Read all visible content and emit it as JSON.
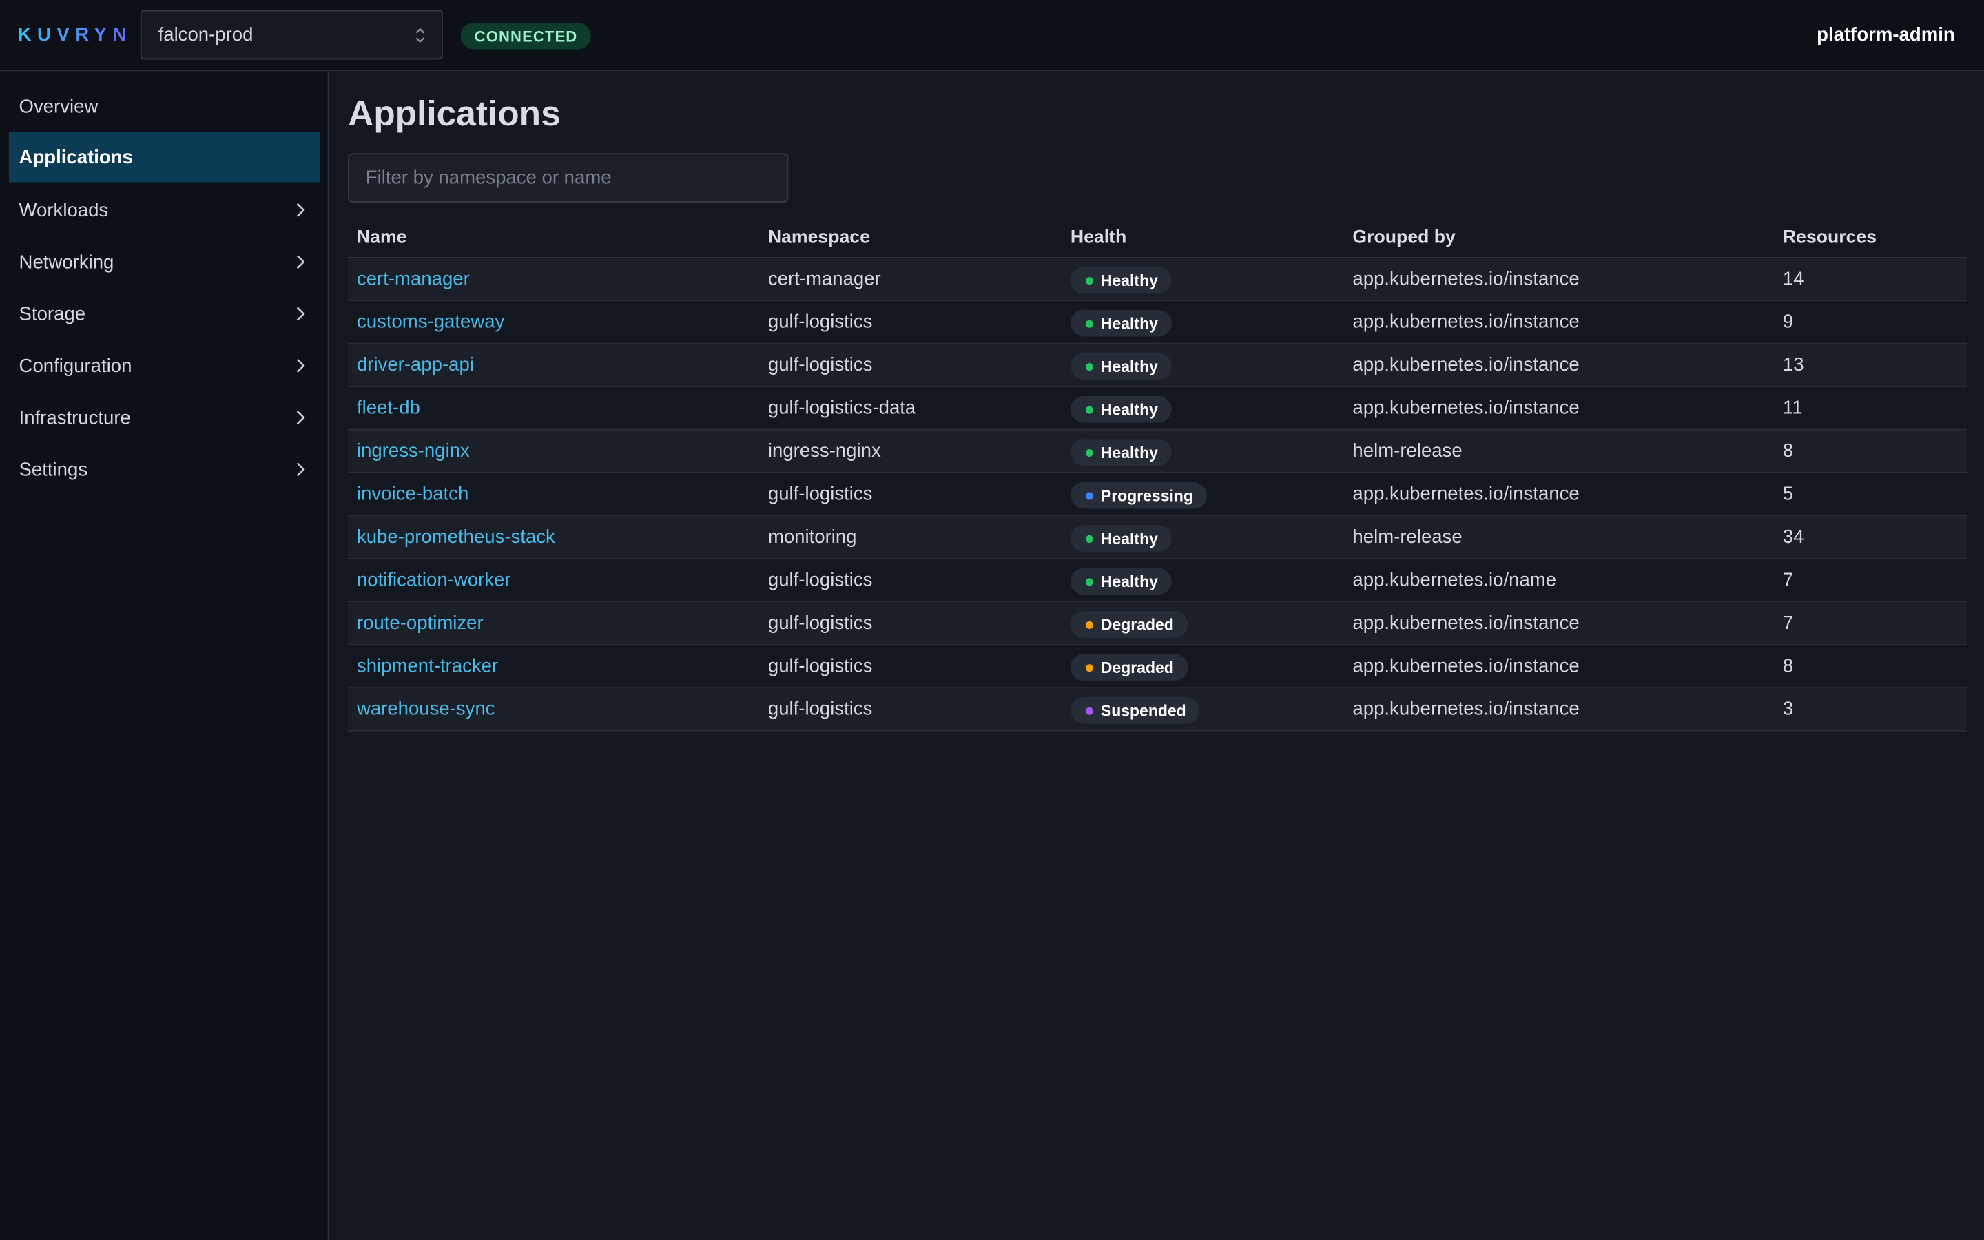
{
  "header": {
    "logo": "KUVRYN",
    "cluster": "falcon-prod",
    "status": "CONNECTED",
    "user": "platform-admin"
  },
  "sidebar": {
    "items": [
      {
        "label": "Overview",
        "active": false,
        "has_children": false
      },
      {
        "label": "Applications",
        "active": true,
        "has_children": false
      },
      {
        "label": "Workloads",
        "active": false,
        "has_children": true
      },
      {
        "label": "Networking",
        "active": false,
        "has_children": true
      },
      {
        "label": "Storage",
        "active": false,
        "has_children": true
      },
      {
        "label": "Configuration",
        "active": false,
        "has_children": true
      },
      {
        "label": "Infrastructure",
        "active": false,
        "has_children": true
      },
      {
        "label": "Settings",
        "active": false,
        "has_children": true
      }
    ]
  },
  "main": {
    "title": "Applications",
    "filter_placeholder": "Filter by namespace or name",
    "filter_value": "",
    "columns": [
      "Name",
      "Namespace",
      "Health",
      "Grouped by",
      "Resources"
    ],
    "rows": [
      {
        "name": "cert-manager",
        "namespace": "cert-manager",
        "health": "Healthy",
        "grouped_by": "app.kubernetes.io/instance",
        "resources": "14"
      },
      {
        "name": "customs-gateway",
        "namespace": "gulf-logistics",
        "health": "Healthy",
        "grouped_by": "app.kubernetes.io/instance",
        "resources": "9"
      },
      {
        "name": "driver-app-api",
        "namespace": "gulf-logistics",
        "health": "Healthy",
        "grouped_by": "app.kubernetes.io/instance",
        "resources": "13"
      },
      {
        "name": "fleet-db",
        "namespace": "gulf-logistics-data",
        "health": "Healthy",
        "grouped_by": "app.kubernetes.io/instance",
        "resources": "11"
      },
      {
        "name": "ingress-nginx",
        "namespace": "ingress-nginx",
        "health": "Healthy",
        "grouped_by": "helm-release",
        "resources": "8"
      },
      {
        "name": "invoice-batch",
        "namespace": "gulf-logistics",
        "health": "Progressing",
        "grouped_by": "app.kubernetes.io/instance",
        "resources": "5"
      },
      {
        "name": "kube-prometheus-stack",
        "namespace": "monitoring",
        "health": "Healthy",
        "grouped_by": "helm-release",
        "resources": "34"
      },
      {
        "name": "notification-worker",
        "namespace": "gulf-logistics",
        "health": "Healthy",
        "grouped_by": "app.kubernetes.io/name",
        "resources": "7"
      },
      {
        "name": "route-optimizer",
        "namespace": "gulf-logistics",
        "health": "Degraded",
        "grouped_by": "app.kubernetes.io/instance",
        "resources": "7"
      },
      {
        "name": "shipment-tracker",
        "namespace": "gulf-logistics",
        "health": "Degraded",
        "grouped_by": "app.kubernetes.io/instance",
        "resources": "8"
      },
      {
        "name": "warehouse-sync",
        "namespace": "gulf-logistics",
        "health": "Suspended",
        "grouped_by": "app.kubernetes.io/instance",
        "resources": "3"
      }
    ]
  },
  "colors": {
    "Healthy": "#22c55e",
    "Progressing": "#3b82f6",
    "Degraded": "#f59e0b",
    "Suspended": "#a855f7",
    "link": "#4cb8e8",
    "active_nav": "#0c3b55"
  },
  "icons": {
    "nav_arrow": "chevron-right-icon",
    "cluster_select": "chevron-updown-icon",
    "health_dot": "status-dot-icon"
  }
}
